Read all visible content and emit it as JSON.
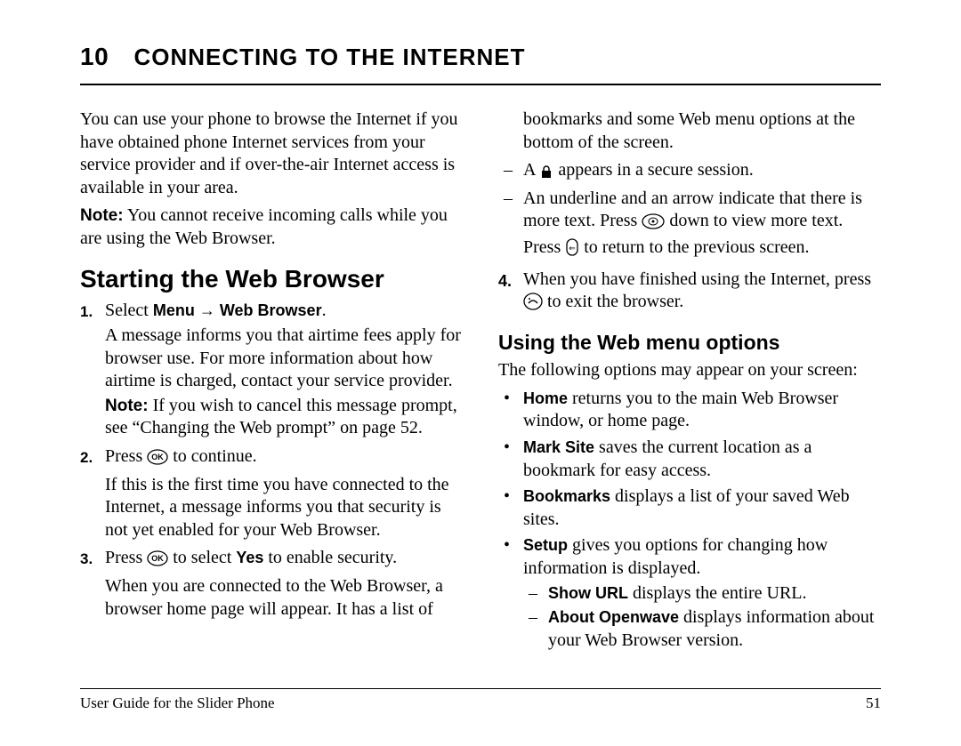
{
  "chapter": {
    "number": "10",
    "title": "Connecting to the Internet"
  },
  "left": {
    "intro": "You can use your phone to browse the Internet if you have obtained phone Internet services from your service provider and if over-the-air Internet access is available in your area.",
    "note_label": "Note:",
    "note_body": " You cannot receive incoming calls while you are using the Web Browser.",
    "h1": "Starting the Web Browser",
    "steps": [
      {
        "lead": "Select ",
        "bold": "Menu → Web Browser",
        "post": ".",
        "body1": "A message informs you that airtime fees apply for browser use. For more information about how airtime is charged, contact your service provider.",
        "inner_note_label": "Note:",
        "inner_note_body": " If you wish to cancel this message prompt, see “Changing the Web prompt” on page 52."
      },
      {
        "lead": "Press ",
        "icon": "ok",
        "post": " to continue.",
        "body1": "If this is the first time you have connected to the Internet, a message informs you that security is not yet enabled for your Web Browser."
      },
      {
        "lead": "Press ",
        "icon": "ok",
        "mid": " to select ",
        "bold": "Yes",
        "post": " to enable security.",
        "body1": "When you are connected to the Web Browser, a browser home page will appear. It has a list of"
      }
    ]
  },
  "right": {
    "cont": "bookmarks and some Web menu options at the bottom of the screen.",
    "dashes": [
      {
        "pre": "A ",
        "icon": "lock",
        "post": " appears in a secure session."
      },
      {
        "text": "An underline and an arrow indicate that there is more text. Press ",
        "icon1": "nav",
        "mid": " down to view more text. Press ",
        "icon2": "back",
        "post": " to return to the previous screen."
      }
    ],
    "step4_num": "4.",
    "step4_a": "When you have finished using the Internet, press ",
    "step4_icon": "end",
    "step4_b": " to exit the browser.",
    "h2": "Using the Web menu options",
    "intro2": "The following options may appear on your screen:",
    "bullets": [
      {
        "bold": "Home",
        "text": " returns you to the main Web Browser window, or home page."
      },
      {
        "bold": "Mark Site",
        "text": " saves the current location as a bookmark for easy access."
      },
      {
        "bold": "Bookmarks",
        "text": " displays a list of your saved Web sites."
      },
      {
        "bold": "Setup",
        "text": " gives you options for changing how information is displayed.",
        "sub": [
          {
            "bold": "Show URL",
            "text": " displays the entire URL."
          },
          {
            "bold": "About Openwave",
            "text": " displays information about your Web Browser version."
          }
        ]
      }
    ]
  },
  "footer": {
    "left": "User Guide for the Slider Phone",
    "right": "51"
  }
}
